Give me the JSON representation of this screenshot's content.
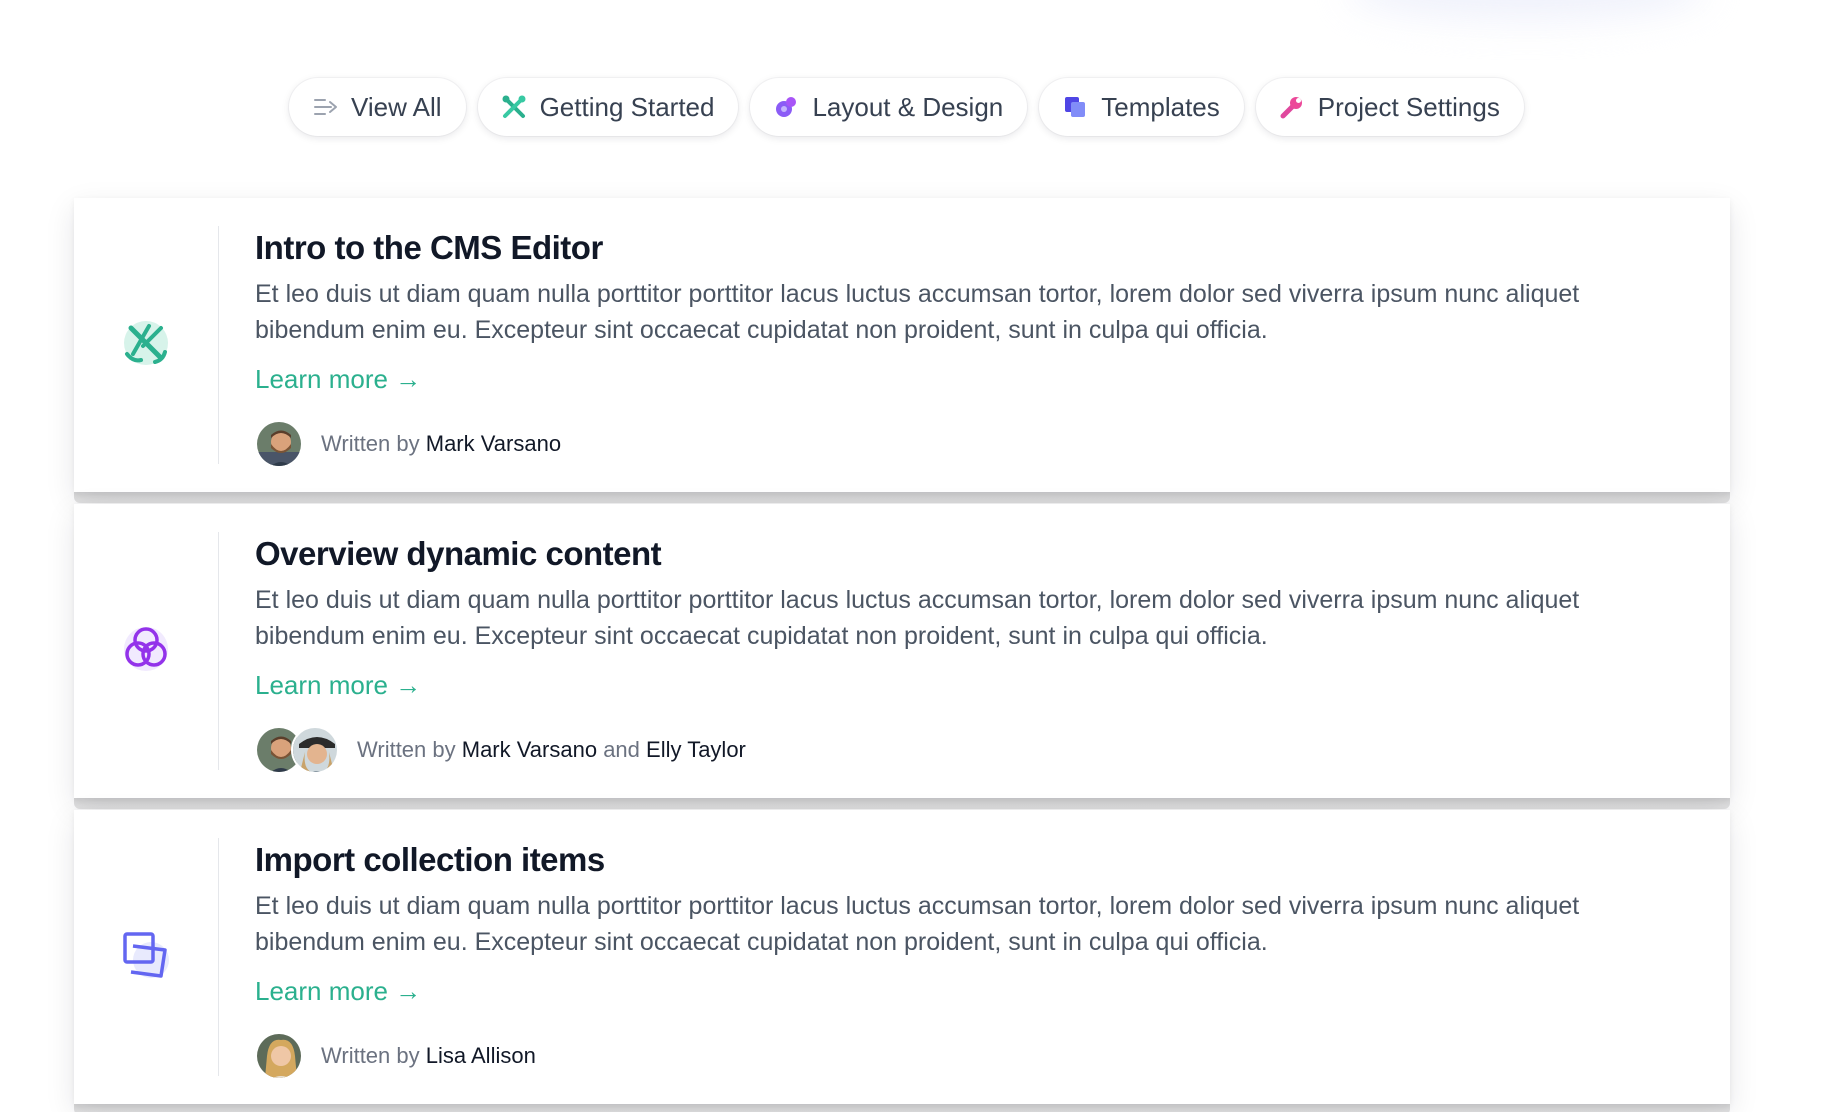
{
  "filters": [
    {
      "label": "View All",
      "icon": "list-arrow-icon"
    },
    {
      "label": "Getting Started",
      "icon": "tools-icon"
    },
    {
      "label": "Layout & Design",
      "icon": "paint-blob-icon"
    },
    {
      "label": "Templates",
      "icon": "copy-pages-icon"
    },
    {
      "label": "Project Settings",
      "icon": "wrench-icon"
    }
  ],
  "articles": [
    {
      "title": "Intro to the CMS Editor",
      "description": "Et leo duis ut diam quam nulla porttitor porttitor lacus luctus accumsan tortor, lorem dolor sed viverra ipsum nunc aliquet bibendum enim eu. Excepteur sint occaecat cupidatat non proident, sunt in culpa qui officia.",
      "link": "Learn more →",
      "written_by": "Written by",
      "author_1": "Mark Varsano",
      "icon": "tools-icon"
    },
    {
      "title": "Overview dynamic content",
      "description": "Et leo duis ut diam quam nulla porttitor porttitor lacus luctus accumsan tortor, lorem dolor sed viverra ipsum nunc aliquet bibendum enim eu. Excepteur sint occaecat cupidatat non proident, sunt in culpa qui officia.",
      "link": "Learn more →",
      "written_by": "Written by",
      "author_1": "Mark Varsano",
      "joiner": "and",
      "author_2": "Elly Taylor",
      "icon": "venn-circles-icon"
    },
    {
      "title": "Import collection items",
      "description": "Et leo duis ut diam quam nulla porttitor porttitor lacus luctus accumsan tortor, lorem dolor sed viverra ipsum nunc aliquet bibendum enim eu. Excepteur sint occaecat cupidatat non proident, sunt in culpa qui officia.",
      "link": "Learn more →",
      "written_by": "Written by",
      "author_1": "Lisa Allison",
      "icon": "stacked-squares-icon"
    }
  ],
  "colors": {
    "accent_teal": "#2bb08e",
    "accent_purple": "#8b5cf6",
    "accent_indigo": "#6366f1",
    "accent_pink": "#e0489e"
  }
}
